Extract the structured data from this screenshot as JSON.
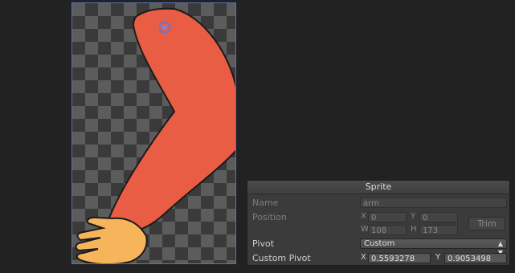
{
  "panel": {
    "title": "Sprite",
    "name_label": "Name",
    "name_value": "arm",
    "position_label": "Position",
    "x_axis": "X",
    "x_value": "0",
    "y_axis": "Y",
    "y_value": "0",
    "w_axis": "W",
    "w_value": "108",
    "h_axis": "H",
    "h_value": "173",
    "trim_label": "Trim",
    "pivot_label": "Pivot",
    "pivot_value": "Custom",
    "custom_pivot_label": "Custom Pivot",
    "cp_x_axis": "X",
    "cp_x_value": "0.5593278",
    "cp_y_axis": "Y",
    "cp_y_value": "0.9053498"
  },
  "icons": {
    "pivot_handle": "pivot-handle-icon",
    "select_arrows": "up-down-arrows-icon"
  },
  "colors": {
    "arm": "#e85d43",
    "hand": "#f6b55a",
    "selection_border": "#5a73b8",
    "pivot_handle": "#6a73d0"
  }
}
